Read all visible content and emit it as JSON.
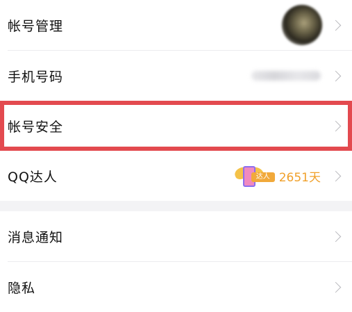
{
  "group1": {
    "account": {
      "label": "帐号管理"
    },
    "phone": {
      "label": "手机号码"
    },
    "security": {
      "label": "帐号安全"
    },
    "qq_daren": {
      "label": "QQ达人",
      "badge_text": "达人",
      "days": "2651天"
    }
  },
  "group2": {
    "notifications": {
      "label": "消息通知"
    },
    "privacy": {
      "label": "隐私"
    }
  },
  "colors": {
    "highlight_border": "#e34a4f",
    "days_text": "#f0a02a",
    "background": "#f3f3f5"
  }
}
